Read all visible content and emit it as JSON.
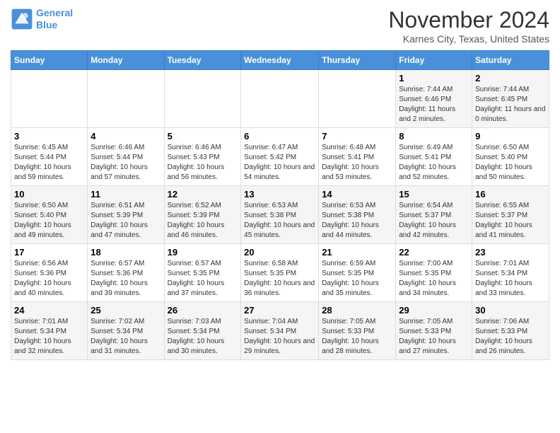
{
  "header": {
    "logo_line1": "General",
    "logo_line2": "Blue",
    "month": "November 2024",
    "location": "Karnes City, Texas, United States"
  },
  "days_of_week": [
    "Sunday",
    "Monday",
    "Tuesday",
    "Wednesday",
    "Thursday",
    "Friday",
    "Saturday"
  ],
  "weeks": [
    [
      {
        "day": "",
        "info": ""
      },
      {
        "day": "",
        "info": ""
      },
      {
        "day": "",
        "info": ""
      },
      {
        "day": "",
        "info": ""
      },
      {
        "day": "",
        "info": ""
      },
      {
        "day": "1",
        "info": "Sunrise: 7:44 AM\nSunset: 6:46 PM\nDaylight: 11 hours and 2 minutes."
      },
      {
        "day": "2",
        "info": "Sunrise: 7:44 AM\nSunset: 6:45 PM\nDaylight: 11 hours and 0 minutes."
      }
    ],
    [
      {
        "day": "3",
        "info": "Sunrise: 6:45 AM\nSunset: 5:44 PM\nDaylight: 10 hours and 59 minutes."
      },
      {
        "day": "4",
        "info": "Sunrise: 6:46 AM\nSunset: 5:44 PM\nDaylight: 10 hours and 57 minutes."
      },
      {
        "day": "5",
        "info": "Sunrise: 6:46 AM\nSunset: 5:43 PM\nDaylight: 10 hours and 56 minutes."
      },
      {
        "day": "6",
        "info": "Sunrise: 6:47 AM\nSunset: 5:42 PM\nDaylight: 10 hours and 54 minutes."
      },
      {
        "day": "7",
        "info": "Sunrise: 6:48 AM\nSunset: 5:41 PM\nDaylight: 10 hours and 53 minutes."
      },
      {
        "day": "8",
        "info": "Sunrise: 6:49 AM\nSunset: 5:41 PM\nDaylight: 10 hours and 52 minutes."
      },
      {
        "day": "9",
        "info": "Sunrise: 6:50 AM\nSunset: 5:40 PM\nDaylight: 10 hours and 50 minutes."
      }
    ],
    [
      {
        "day": "10",
        "info": "Sunrise: 6:50 AM\nSunset: 5:40 PM\nDaylight: 10 hours and 49 minutes."
      },
      {
        "day": "11",
        "info": "Sunrise: 6:51 AM\nSunset: 5:39 PM\nDaylight: 10 hours and 47 minutes."
      },
      {
        "day": "12",
        "info": "Sunrise: 6:52 AM\nSunset: 5:39 PM\nDaylight: 10 hours and 46 minutes."
      },
      {
        "day": "13",
        "info": "Sunrise: 6:53 AM\nSunset: 5:38 PM\nDaylight: 10 hours and 45 minutes."
      },
      {
        "day": "14",
        "info": "Sunrise: 6:53 AM\nSunset: 5:38 PM\nDaylight: 10 hours and 44 minutes."
      },
      {
        "day": "15",
        "info": "Sunrise: 6:54 AM\nSunset: 5:37 PM\nDaylight: 10 hours and 42 minutes."
      },
      {
        "day": "16",
        "info": "Sunrise: 6:55 AM\nSunset: 5:37 PM\nDaylight: 10 hours and 41 minutes."
      }
    ],
    [
      {
        "day": "17",
        "info": "Sunrise: 6:56 AM\nSunset: 5:36 PM\nDaylight: 10 hours and 40 minutes."
      },
      {
        "day": "18",
        "info": "Sunrise: 6:57 AM\nSunset: 5:36 PM\nDaylight: 10 hours and 39 minutes."
      },
      {
        "day": "19",
        "info": "Sunrise: 6:57 AM\nSunset: 5:35 PM\nDaylight: 10 hours and 37 minutes."
      },
      {
        "day": "20",
        "info": "Sunrise: 6:58 AM\nSunset: 5:35 PM\nDaylight: 10 hours and 36 minutes."
      },
      {
        "day": "21",
        "info": "Sunrise: 6:59 AM\nSunset: 5:35 PM\nDaylight: 10 hours and 35 minutes."
      },
      {
        "day": "22",
        "info": "Sunrise: 7:00 AM\nSunset: 5:35 PM\nDaylight: 10 hours and 34 minutes."
      },
      {
        "day": "23",
        "info": "Sunrise: 7:01 AM\nSunset: 5:34 PM\nDaylight: 10 hours and 33 minutes."
      }
    ],
    [
      {
        "day": "24",
        "info": "Sunrise: 7:01 AM\nSunset: 5:34 PM\nDaylight: 10 hours and 32 minutes."
      },
      {
        "day": "25",
        "info": "Sunrise: 7:02 AM\nSunset: 5:34 PM\nDaylight: 10 hours and 31 minutes."
      },
      {
        "day": "26",
        "info": "Sunrise: 7:03 AM\nSunset: 5:34 PM\nDaylight: 10 hours and 30 minutes."
      },
      {
        "day": "27",
        "info": "Sunrise: 7:04 AM\nSunset: 5:34 PM\nDaylight: 10 hours and 29 minutes."
      },
      {
        "day": "28",
        "info": "Sunrise: 7:05 AM\nSunset: 5:33 PM\nDaylight: 10 hours and 28 minutes."
      },
      {
        "day": "29",
        "info": "Sunrise: 7:05 AM\nSunset: 5:33 PM\nDaylight: 10 hours and 27 minutes."
      },
      {
        "day": "30",
        "info": "Sunrise: 7:06 AM\nSunset: 5:33 PM\nDaylight: 10 hours and 26 minutes."
      }
    ]
  ]
}
